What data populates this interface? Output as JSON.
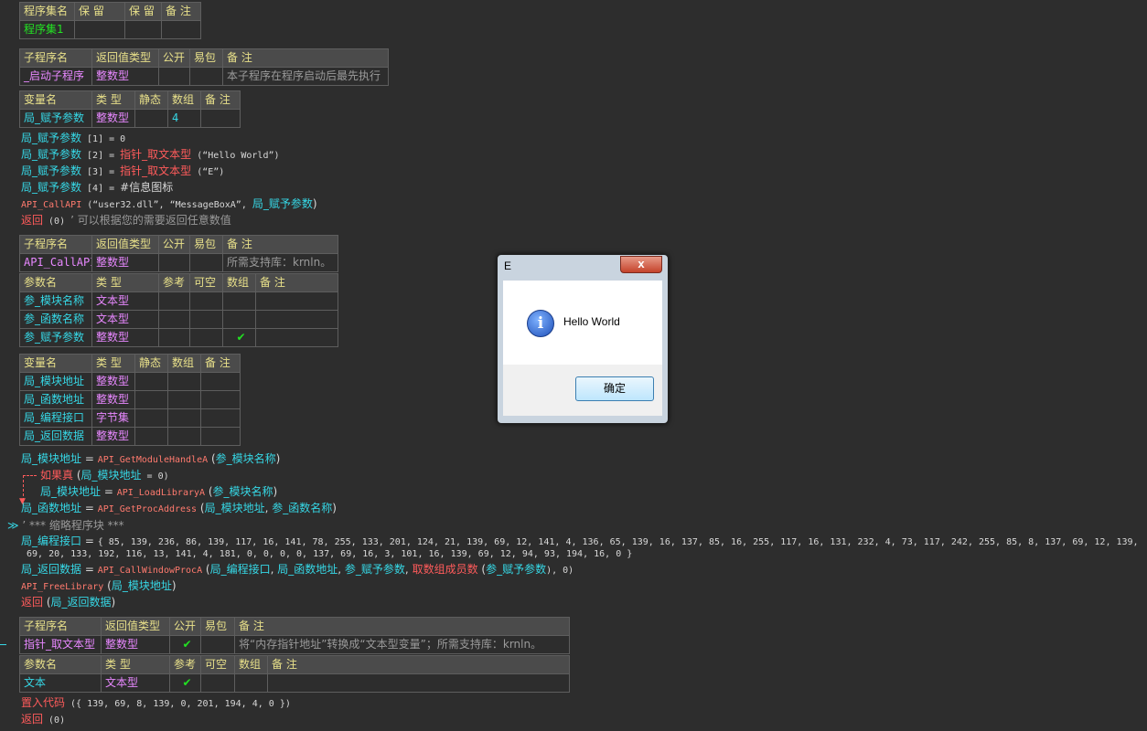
{
  "prog_set_table": {
    "headers": [
      "程序集名",
      "保 留",
      "保 留",
      "备 注"
    ],
    "row": [
      "程序集1",
      "",
      "",
      ""
    ]
  },
  "sub1": {
    "headers": [
      "子程序名",
      "返回值类型",
      "公开",
      "易包",
      "备 注"
    ],
    "row": [
      "_启动子程序",
      "整数型",
      "",
      "",
      "本子程序在程序启动后最先执行"
    ],
    "var_headers": [
      "变量名",
      "类 型",
      "静态",
      "数组",
      "备 注"
    ],
    "var_row": [
      "局_赋予参数",
      "整数型",
      "",
      "4",
      ""
    ]
  },
  "code1": [
    [
      "局_赋予参数",
      " [1] = ",
      "0",
      "",
      "",
      ""
    ],
    [
      "局_赋予参数",
      " [2] = ",
      "指针_取文本型",
      " (“Hello World”) ",
      "",
      ""
    ],
    [
      "局_赋予参数",
      " [3] = ",
      "指针_取文本型",
      " (“E”) ",
      "",
      ""
    ],
    [
      "局_赋予参数",
      " [4] = ",
      "#信息图标",
      "",
      "",
      ""
    ]
  ],
  "code1_call": {
    "fn": "API_CallAPI",
    "args": " (“user32.dll”, “MessageBoxA”, ",
    "arg3": "局_赋予参数",
    "close": ")"
  },
  "code1_return": {
    "kw": "返回",
    "val": " (0) ",
    "comment": "’ 可以根据您的需要返回任意数值"
  },
  "sub2": {
    "headers": [
      "子程序名",
      "返回值类型",
      "公开",
      "易包",
      "备 注"
    ],
    "row": [
      "API_CallAPI",
      "整数型",
      "",
      "",
      "所需支持库：krnln。"
    ],
    "param_headers": [
      "参数名",
      "类 型",
      "参考",
      "可空",
      "数组",
      "备 注"
    ],
    "params": [
      [
        "参_模块名称",
        "文本型",
        "",
        "",
        "",
        ""
      ],
      [
        "参_函数名称",
        "文本型",
        "",
        "",
        "",
        ""
      ],
      [
        "参_赋予参数",
        "整数型",
        "",
        "",
        "✔",
        ""
      ]
    ],
    "var_headers": [
      "变量名",
      "类 型",
      "静态",
      "数组",
      "备 注"
    ],
    "vars": [
      [
        "局_模块地址",
        "整数型",
        "",
        "",
        ""
      ],
      [
        "局_函数地址",
        "整数型",
        "",
        "",
        ""
      ],
      [
        "局_编程接口",
        "字节集",
        "",
        "",
        ""
      ],
      [
        "局_返回数据",
        "整数型",
        "",
        "",
        ""
      ]
    ]
  },
  "code2": {
    "l1": {
      "a": "局_模块地址",
      "eq": " = ",
      "fn": "API_GetModuleHandleA",
      "p": " (",
      "arg": "参_模块名称",
      "c": ")"
    },
    "l2": {
      "kw": "如果真",
      "p": " (",
      "a": "局_模块地址",
      "rest": " = 0)"
    },
    "l3": {
      "a": "局_模块地址",
      "eq": " = ",
      "fn": "API_LoadLibraryA",
      "p": " (",
      "arg": "参_模块名称",
      "c": ")"
    },
    "l4": {
      "a": "局_函数地址",
      "eq": " = ",
      "fn": "API_GetProcAddress",
      "p": " (",
      "arg1": "局_模块地址",
      "sep": ", ",
      "arg2": "参_函数名称",
      "c": ")"
    },
    "l5": {
      "marker": "≫",
      "text": "’ *** 缩略程序块 ***"
    },
    "l6": {
      "a": "局_编程接口",
      "eq": " = ",
      "bytes1": "{ 85, 139, 236, 86, 139, 117, 16, 141, 78, 255, 133, 201, 124, 21, 139, 69, 12, 141, 4, 136, 65, 139, 16, 137, 85, 16, 255, 117, 16, 131, 232, 4, 73, 117, 242, 255, 85, 8, 137, 69, 12, 139,",
      "bytes2": "69, 20, 133, 192, 116, 13, 141, 4, 181, 0, 0, 0, 0, 137, 69, 16, 3, 101, 16, 139, 69, 12, 94, 93, 194, 16, 0 }"
    },
    "l7": {
      "a": "局_返回数据",
      "eq": " = ",
      "fn": "API_CallWindowProcA",
      "p": " (",
      "arg1": "局_编程接口",
      "arg2": "局_函数地址",
      "arg3": "参_赋予参数",
      "fn2": "取数组成员数",
      "arg4": "参_赋予参数",
      "sep": ", ",
      "c": "), 0)"
    },
    "l8": {
      "fn": "API_FreeLibrary",
      "p": " (",
      "arg": "局_模块地址",
      "c": ")"
    },
    "l9": {
      "kw": "返回",
      "p": " (",
      "arg": "局_返回数据",
      "c": ")"
    }
  },
  "sub3": {
    "headers": [
      "子程序名",
      "返回值类型",
      "公开",
      "易包",
      "备 注"
    ],
    "row": [
      "指针_取文本型",
      "整数型",
      "✔",
      "",
      "将“内存指针地址”转换成“文本型变量”；所需支持库：krnln。"
    ],
    "param_headers": [
      "参数名",
      "类 型",
      "参考",
      "可空",
      "数组",
      "备 注"
    ],
    "params": [
      [
        "文本",
        "文本型",
        "✔",
        "",
        "",
        ""
      ]
    ]
  },
  "code3": {
    "l1": {
      "kw": "置入代码",
      "val": " ({ 139, 69, 8, 139, 0, 201, 194, 4, 0 })"
    },
    "l2": {
      "kw": "返回",
      "val": " (0)"
    }
  },
  "dialog": {
    "title": "E",
    "close": "x",
    "message": "Hello World",
    "ok": "确定",
    "icon": "i"
  }
}
